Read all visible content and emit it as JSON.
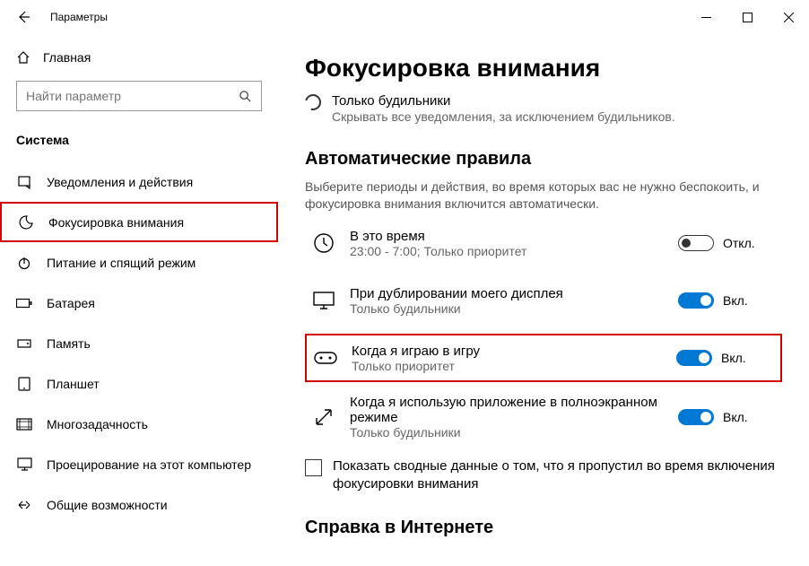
{
  "window": {
    "title": "Параметры"
  },
  "sidebar": {
    "home_label": "Главная",
    "search_placeholder": "Найти параметр",
    "section_title": "Система",
    "items": [
      {
        "label": "Уведомления и действия"
      },
      {
        "label": "Фокусировка внимания"
      },
      {
        "label": "Питание и спящий режим"
      },
      {
        "label": "Батарея"
      },
      {
        "label": "Память"
      },
      {
        "label": "Планшет"
      },
      {
        "label": "Многозадачность"
      },
      {
        "label": "Проецирование на этот компьютер"
      },
      {
        "label": "Общие возможности"
      }
    ]
  },
  "main": {
    "title": "Фокусировка внимания",
    "radio": {
      "label": "Только будильники",
      "sub": "Скрывать все уведомления, за исключением будильников."
    },
    "auto_title": "Автоматические правила",
    "auto_desc": "Выберите периоды и действия, во время которых вас не нужно беспокоить, и фокусировка внимания включится автоматически.",
    "rules": [
      {
        "title": "В это время",
        "sub": "23:00 - 7:00; Только приоритет",
        "state_label": "Откл."
      },
      {
        "title": "При дублировании моего дисплея",
        "sub": "Только будильники",
        "state_label": "Вкл."
      },
      {
        "title": "Когда я играю в игру",
        "sub": "Только приоритет",
        "state_label": "Вкл."
      },
      {
        "title": "Когда я использую приложение в полноэкранном режиме",
        "sub": "Только будильники",
        "state_label": "Вкл."
      }
    ],
    "checkbox_label": "Показать сводные данные о том, что я пропустил во время включения фокусировки внимания",
    "help_title": "Справка в Интернете"
  }
}
